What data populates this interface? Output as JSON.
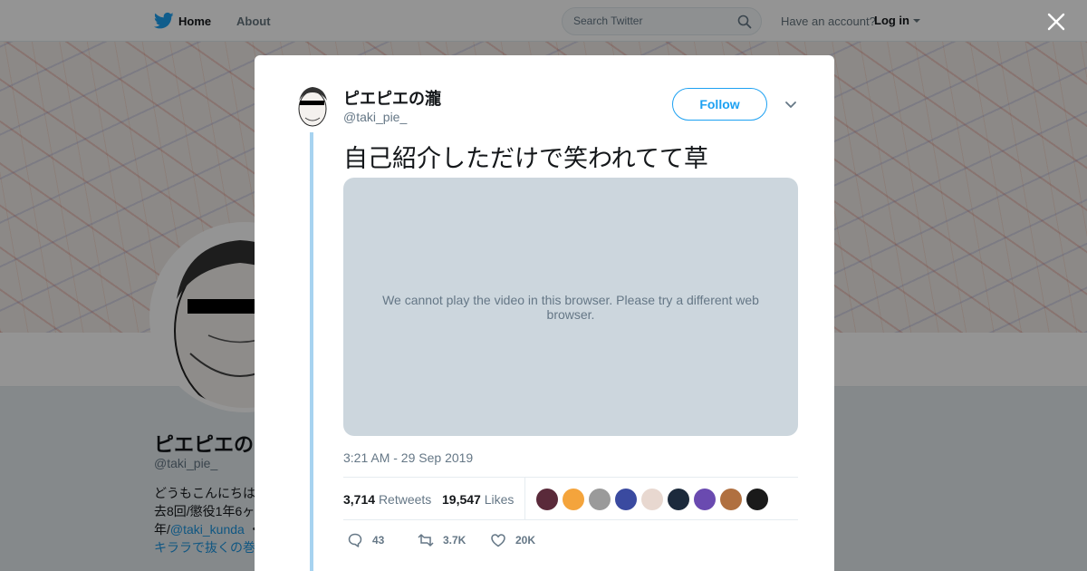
{
  "nav": {
    "logo_icon": "twitter-bird-icon",
    "home": "Home",
    "about": "About",
    "search_placeholder": "Search Twitter",
    "account_question": "Have an account?",
    "login": "Log in"
  },
  "profile": {
    "name": "ピエピエの",
    "handle": "@taki_pie_",
    "bio_line1": "どうもこんにちは",
    "bio_line2": "去8回/懲役1年6ヶ",
    "bio_line3_prefix": "年/",
    "bio_link1": "@taki_kunda",
    "bio_line3_suffix": " ・",
    "bio_link2": "キララで抜くの巻"
  },
  "tweet": {
    "author_name": "ピエピエの瀧",
    "author_handle": "@taki_pie_",
    "follow_label": "Follow",
    "text": "自己紹介しただけで笑われてて草",
    "video_message": "We cannot play the video in this browser. Please try a different web browser.",
    "timestamp": "3:21 AM - 29 Sep 2019",
    "retweets_count": "3,714",
    "retweets_label": "Retweets",
    "likes_count": "19,547",
    "likes_label": "Likes",
    "replies_short": "43",
    "retweets_short": "3.7K",
    "likes_short": "20K"
  },
  "likers": [
    {
      "color": "#5a2a3a"
    },
    {
      "color": "#f4a43c"
    },
    {
      "color": "#9a9a9a"
    },
    {
      "color": "#3a4aa0"
    },
    {
      "color": "#e8d8d0"
    },
    {
      "color": "#1c2a3c"
    },
    {
      "color": "#6a4ab0"
    },
    {
      "color": "#b07040"
    },
    {
      "color": "#1a1a1a"
    }
  ],
  "colors": {
    "accent": "#1da1f2",
    "thread_line": "#a7d3f0",
    "video_bg": "#ccd6dd"
  }
}
